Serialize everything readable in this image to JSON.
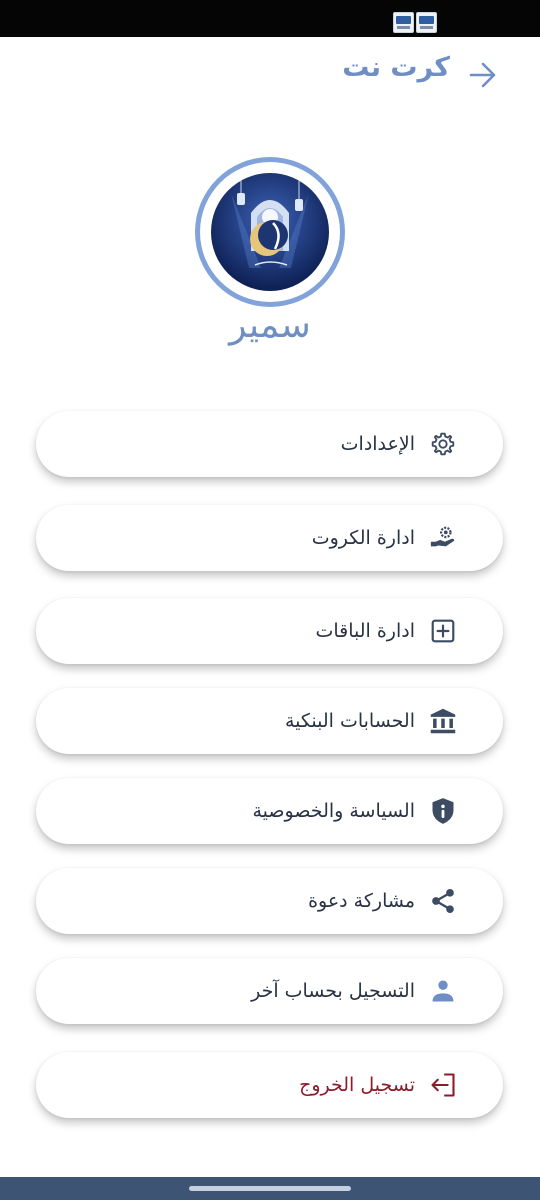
{
  "header": {
    "title": "كرت نت",
    "back_icon": "arrow-right-icon"
  },
  "profile": {
    "name": "سمير",
    "avatar_icon": "crescent-mosque-avatar"
  },
  "menu": [
    {
      "label": "الإعدادات",
      "icon": "gear-icon"
    },
    {
      "label": "ادارة الكروت",
      "icon": "hand-gear-icon"
    },
    {
      "label": "ادارة الباقات",
      "icon": "plus-square-icon"
    },
    {
      "label": "الحسابات البنكية",
      "icon": "bank-icon"
    },
    {
      "label": "السياسة والخصوصية",
      "icon": "shield-info-icon"
    },
    {
      "label": "مشاركة دعوة",
      "icon": "share-icon"
    },
    {
      "label": "التسجيل بحساب آخر",
      "icon": "person-icon"
    },
    {
      "label": "تسجيل الخروج",
      "icon": "logout-icon"
    }
  ],
  "colors": {
    "accent": "#6f8fc4",
    "avatar_ring": "#82a3da",
    "text": "#2a3344",
    "icon": "#3d4c63",
    "logout": "#8b1c2c",
    "nav_bar": "#3e5475"
  }
}
